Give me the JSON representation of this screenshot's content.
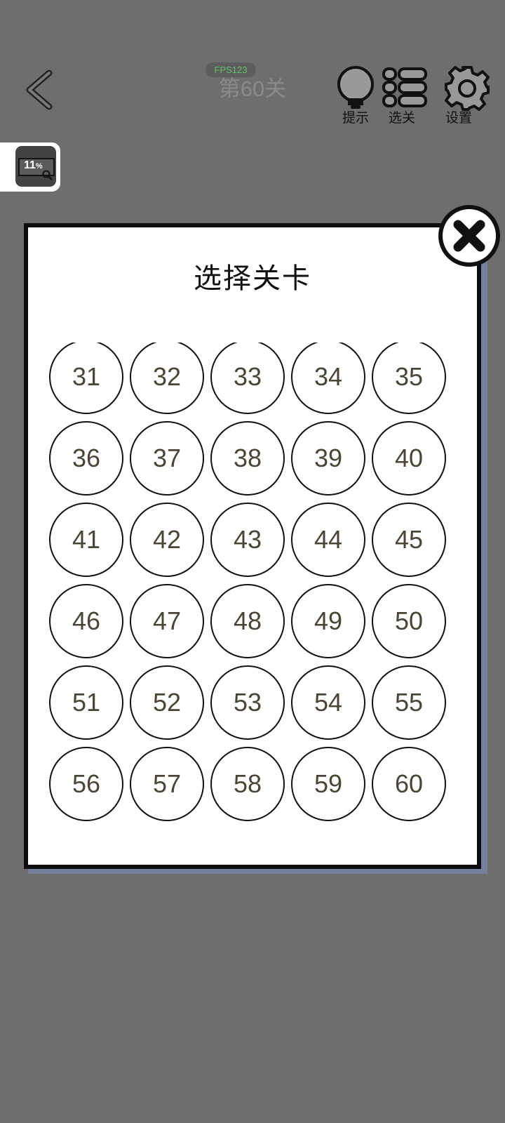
{
  "header": {
    "fps": "FPS123",
    "level_title": "第60关",
    "hint_label": "提示",
    "select_label": "选关",
    "settings_label": "设置"
  },
  "progress": {
    "value": "11",
    "unit": "%"
  },
  "modal": {
    "title": "选择关卡",
    "levels": [
      "31",
      "32",
      "33",
      "34",
      "35",
      "36",
      "37",
      "38",
      "39",
      "40",
      "41",
      "42",
      "43",
      "44",
      "45",
      "46",
      "47",
      "48",
      "49",
      "50",
      "51",
      "52",
      "53",
      "54",
      "55",
      "56",
      "57",
      "58",
      "59",
      "60"
    ]
  },
  "colors": {
    "background": "#6e6e6e",
    "fps_text": "#5fc36a",
    "number_text": "#4b4536"
  }
}
